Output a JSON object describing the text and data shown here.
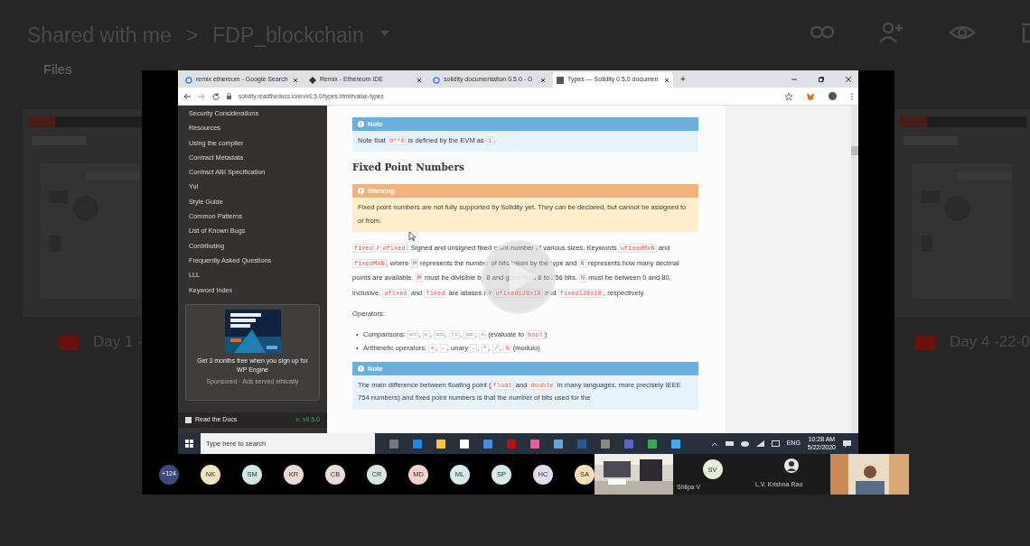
{
  "drive": {
    "breadcrumb": [
      "Shared with me",
      "FDP_blockchain"
    ],
    "separator": ">",
    "section": "Files",
    "files": [
      {
        "name": "Day 1 -"
      },
      {
        "name": "Day 4 -22-0"
      }
    ]
  },
  "browser": {
    "tabs": [
      {
        "title": "remix ethereum - Google Search",
        "selected": false
      },
      {
        "title": "Remix - Ethereum IDE",
        "selected": false
      },
      {
        "title": "solidity documentation 0.5.0 - G",
        "selected": false
      },
      {
        "title": "Types — Solidity 0.5.0 documen",
        "selected": true
      }
    ],
    "new_tab": "+",
    "url": "solidity.readthedocs.io/en/v0.5.0/types.html#value-types"
  },
  "docs_sidebar": {
    "items": [
      "Security Considerations",
      "Resources",
      "Using the compiler",
      "Contract Metadata",
      "Contract ABI Specification",
      "Yul",
      "Style Guide",
      "Common Patterns",
      "List of Known Bugs",
      "Contributing",
      "Frequently Asked Questions",
      "LLL",
      "Keyword Index"
    ],
    "ad": {
      "text": "Get 3 months free when you sign up for WP Engine",
      "note": "Sponsored · Ads served ethically"
    },
    "footer": {
      "label": "Read the Docs",
      "version": "v: v0.5.0"
    }
  },
  "doc": {
    "blocks": [
      {
        "kind": "note",
        "title": "Note",
        "segments": [
          {
            "kind": "text",
            "text": "Note that "
          },
          {
            "kind": "code",
            "text": "0**0"
          },
          {
            "kind": "text",
            "text": " is defined by the EVM as "
          },
          {
            "kind": "code",
            "text": "1"
          },
          {
            "kind": "text",
            "text": "."
          }
        ]
      },
      {
        "kind": "heading",
        "text": "Fixed Point Numbers"
      },
      {
        "kind": "warning",
        "title": "Warning",
        "segments": [
          {
            "kind": "text",
            "text": "Fixed point numbers are not fully supported by Solidity yet. They can be declared, but cannot be assigned to or from."
          }
        ]
      },
      {
        "kind": "paragraph",
        "segments": [
          {
            "kind": "code",
            "text": "fixed"
          },
          {
            "kind": "text",
            "text": " / "
          },
          {
            "kind": "code",
            "text": "ufixed"
          },
          {
            "kind": "text",
            "text": ": Signed and unsigned fixed point number of various sizes. Keywords "
          },
          {
            "kind": "code",
            "text": "ufixedMxN"
          },
          {
            "kind": "text",
            "text": " and "
          },
          {
            "kind": "code",
            "text": "fixedMxN"
          },
          {
            "kind": "text",
            "text": ", where "
          },
          {
            "kind": "code",
            "text": "M"
          },
          {
            "kind": "text",
            "text": " represents the number of bits taken by the type and "
          },
          {
            "kind": "code",
            "text": "N"
          },
          {
            "kind": "text",
            "text": " represents how many decimal points are available. "
          },
          {
            "kind": "code",
            "text": "M"
          },
          {
            "kind": "text",
            "text": " must be divisible by 8 and goes from 8 to 256 bits. "
          },
          {
            "kind": "code",
            "text": "N"
          },
          {
            "kind": "text",
            "text": " must be between 0 and 80, inclusive. "
          },
          {
            "kind": "code",
            "text": "ufixed"
          },
          {
            "kind": "text",
            "text": " and "
          },
          {
            "kind": "code",
            "text": "fixed"
          },
          {
            "kind": "text",
            "text": " are aliases for "
          },
          {
            "kind": "code",
            "text": "ufixed128x18"
          },
          {
            "kind": "text",
            "text": " and "
          },
          {
            "kind": "code",
            "text": "fixed128x18"
          },
          {
            "kind": "text",
            "text": ", respectively."
          }
        ]
      },
      {
        "kind": "paragraph",
        "segments": [
          {
            "kind": "text",
            "text": "Operators:"
          }
        ]
      },
      {
        "kind": "list",
        "marker": "•",
        "items": [
          {
            "segments": [
              {
                "kind": "text",
                "text": "Comparisons: "
              },
              {
                "kind": "code",
                "text": "<="
              },
              {
                "kind": "text",
                "text": ", "
              },
              {
                "kind": "code",
                "text": "<"
              },
              {
                "kind": "text",
                "text": ", "
              },
              {
                "kind": "code",
                "text": "=="
              },
              {
                "kind": "text",
                "text": ", "
              },
              {
                "kind": "code",
                "text": "!="
              },
              {
                "kind": "text",
                "text": ", "
              },
              {
                "kind": "code",
                "text": ">="
              },
              {
                "kind": "text",
                "text": ", "
              },
              {
                "kind": "code",
                "text": ">"
              },
              {
                "kind": "text",
                "text": " (evaluate to "
              },
              {
                "kind": "code",
                "text": "bool"
              },
              {
                "kind": "text",
                "text": ")"
              }
            ]
          },
          {
            "segments": [
              {
                "kind": "text",
                "text": "Arithmetic operators: "
              },
              {
                "kind": "code",
                "text": "+"
              },
              {
                "kind": "text",
                "text": ", "
              },
              {
                "kind": "code",
                "text": "-"
              },
              {
                "kind": "text",
                "text": ", unary "
              },
              {
                "kind": "code",
                "text": "-"
              },
              {
                "kind": "text",
                "text": ", "
              },
              {
                "kind": "code",
                "text": "*"
              },
              {
                "kind": "text",
                "text": ", "
              },
              {
                "kind": "code",
                "text": "/"
              },
              {
                "kind": "text",
                "text": ", "
              },
              {
                "kind": "code",
                "text": "%"
              },
              {
                "kind": "text",
                "text": " (modulo)"
              }
            ]
          }
        ]
      },
      {
        "kind": "note",
        "title": "Note",
        "segments": [
          {
            "kind": "text",
            "text": "The main difference between floating point ("
          },
          {
            "kind": "code",
            "text": "float"
          },
          {
            "kind": "text",
            "text": " and "
          },
          {
            "kind": "code",
            "text": "double"
          },
          {
            "kind": "text",
            "text": " in many languages, more precisely IEEE 754 numbers) and fixed point numbers is that the number of bits used for the"
          }
        ]
      }
    ]
  },
  "taskbar": {
    "search_placeholder": "Type here to search",
    "language": "ENG",
    "time": "10:28 AM",
    "date": "5/22/2020"
  },
  "meeting": {
    "overflow_count": "+124",
    "participants": [
      {
        "initials": "NK",
        "color": "#f3e3c3"
      },
      {
        "initials": "SM",
        "color": "#cfe9e6"
      },
      {
        "initials": "KR",
        "color": "#ecd9d3"
      },
      {
        "initials": "CB",
        "color": "#eaddd7"
      },
      {
        "initials": "CR",
        "color": "#d5e8de"
      },
      {
        "initials": "MD",
        "color": "#f4d3cb"
      },
      {
        "initials": "ML",
        "color": "#d5ecef"
      },
      {
        "initials": "SP",
        "color": "#d2ebe7"
      },
      {
        "initials": "HC",
        "color": "#e2dcee"
      },
      {
        "initials": "SA",
        "color": "#f6e0b3"
      }
    ],
    "tiles": [
      {
        "kind": "picture"
      },
      {
        "kind": "initials",
        "initials": "SV",
        "name": "Shilpa V"
      },
      {
        "kind": "avatar",
        "name": "L.V. Krishna Rao"
      },
      {
        "kind": "picture"
      }
    ]
  }
}
